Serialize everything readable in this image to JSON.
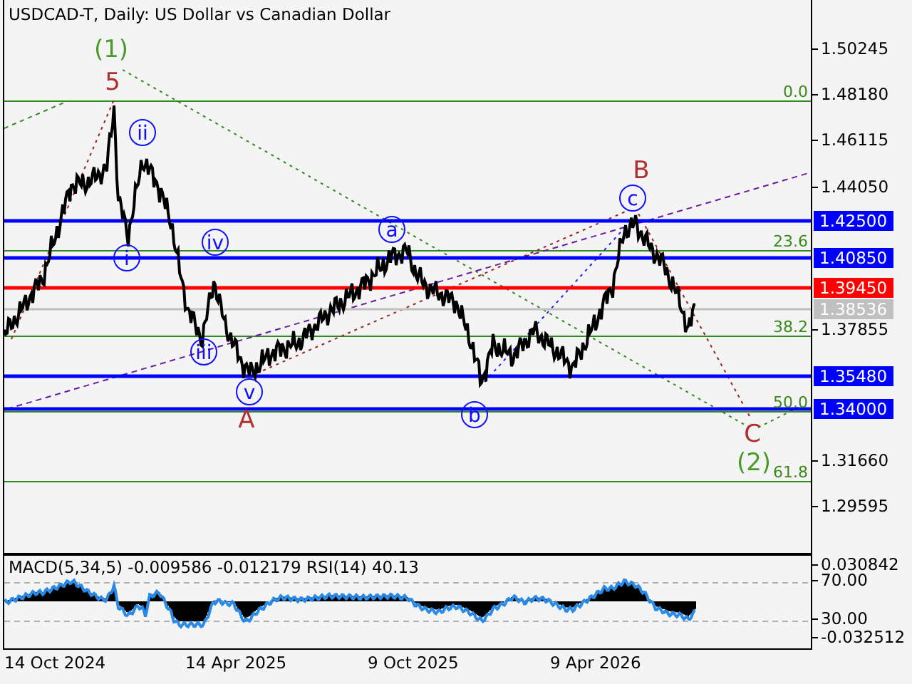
{
  "chart": {
    "title": "USDCAD-T, Daily:  US Dollar vs Canadian Dollar",
    "price_ticks": [
      "1.50245",
      "1.48180",
      "1.46115",
      "1.44050",
      "1.37855",
      "1.31660",
      "1.29595"
    ],
    "levels": [
      {
        "price": "1.42500",
        "color": "#0000ff"
      },
      {
        "price": "1.40850",
        "color": "#0000ff"
      },
      {
        "price": "1.39450",
        "color": "#ff0000"
      },
      {
        "price": "1.38536",
        "color": "#c0c0c0"
      },
      {
        "price": "1.35480",
        "color": "#0000ff"
      },
      {
        "price": "1.34000",
        "color": "#0000ff"
      }
    ],
    "fibonacci": [
      "0.0",
      "23.6",
      "38.2",
      "50.0",
      "61.8"
    ],
    "wave_labels": [
      {
        "text": "(1)",
        "kind": "plain",
        "color": "#4a9a2a"
      },
      {
        "text": "5",
        "kind": "plain",
        "color": "#b03030"
      },
      {
        "text": "ii",
        "kind": "circle",
        "color": "#1010ff"
      },
      {
        "text": "i",
        "kind": "circle",
        "color": "#1010ff"
      },
      {
        "text": "iv",
        "kind": "circle",
        "color": "#1010ff"
      },
      {
        "text": "iii",
        "kind": "circle",
        "color": "#1010ff"
      },
      {
        "text": "v",
        "kind": "circle",
        "color": "#1010ff"
      },
      {
        "text": "A",
        "kind": "plain",
        "color": "#b03030"
      },
      {
        "text": "a",
        "kind": "circle",
        "color": "#1010ff"
      },
      {
        "text": "b",
        "kind": "circle",
        "color": "#1010ff"
      },
      {
        "text": "B",
        "kind": "plain",
        "color": "#b03030"
      },
      {
        "text": "c",
        "kind": "circle",
        "color": "#1010ff"
      },
      {
        "text": "C",
        "kind": "plain",
        "color": "#b03030"
      },
      {
        "text": "(2)",
        "kind": "plain",
        "color": "#4a9a2a"
      }
    ]
  },
  "indicator": {
    "title": "MACD(5,34,5) -0.009586 -0.012179 RSI(14) 40.13",
    "ticks": [
      "0.030842",
      "70.00",
      "30.00",
      "-0.032512"
    ]
  },
  "dates": [
    "14 Oct 2024",
    "14 Apr 2025",
    "9 Oct 2025",
    "9 Apr 2026"
  ]
}
